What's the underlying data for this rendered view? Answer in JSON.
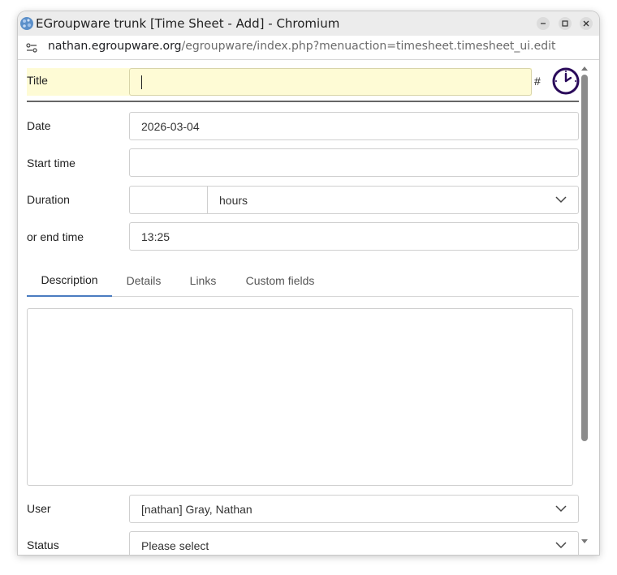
{
  "window": {
    "title": "EGroupware trunk [Time Sheet - Add] - Chromium"
  },
  "addressbar": {
    "host": "nathan.egroupware.org",
    "path": "/egroupware/index.php?menuaction=timesheet.timesheet_ui.edit"
  },
  "form": {
    "title_label": "Title",
    "title_value": "",
    "hash_label": "#",
    "date_label": "Date",
    "date_value": "2026-03-04",
    "start_label": "Start time",
    "start_value": "",
    "duration_label": "Duration",
    "duration_value": "",
    "duration_unit": "hours",
    "end_label": "or end time",
    "end_value": "13:25",
    "user_label": "User",
    "user_value": "[nathan] Gray, Nathan",
    "status_label": "Status",
    "status_value": "Please select"
  },
  "tabs": [
    {
      "label": "Description",
      "active": true
    },
    {
      "label": "Details",
      "active": false
    },
    {
      "label": "Links",
      "active": false
    },
    {
      "label": "Custom fields",
      "active": false
    }
  ],
  "description_value": "",
  "colors": {
    "title_highlight": "#fefbd5",
    "accent": "#4a7cc0",
    "clock_icon": "#2a0a5a"
  },
  "icons": {
    "app": "egroupware-globe-icon",
    "site_info": "site-settings-icon",
    "timesheet": "clock-icon",
    "minimize": "minimize-icon",
    "maximize": "maximize-icon",
    "close": "close-icon",
    "dropdown": "chevron-down-icon"
  }
}
